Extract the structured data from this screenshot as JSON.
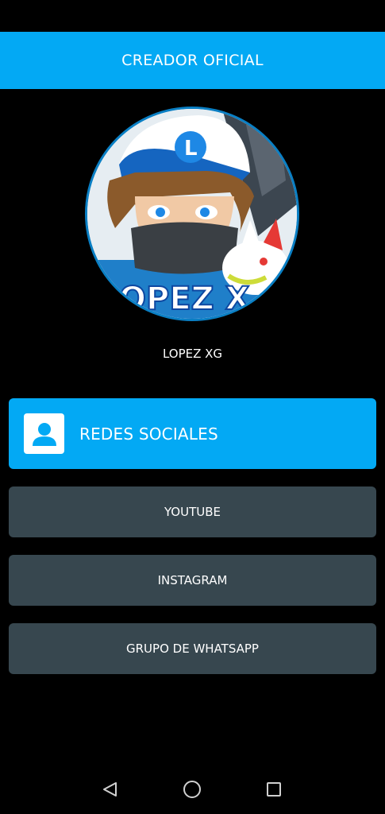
{
  "header": {
    "title": "CREADOR OFICIAL"
  },
  "profile": {
    "name": "LOPEZ XG",
    "avatar_text": "OPEZ X"
  },
  "social_section": {
    "label": "REDES SOCIALES",
    "icon": "contact-icon"
  },
  "links": [
    {
      "label": "YOUTUBE"
    },
    {
      "label": "INSTAGRAM"
    },
    {
      "label": "GRUPO DE WHATSAPP"
    }
  ],
  "nav": {
    "back": "back-triangle-icon",
    "home": "home-circle-icon",
    "recents": "recents-square-icon"
  },
  "colors": {
    "accent": "#03a9f4",
    "button": "#37474f",
    "background": "#000000"
  }
}
